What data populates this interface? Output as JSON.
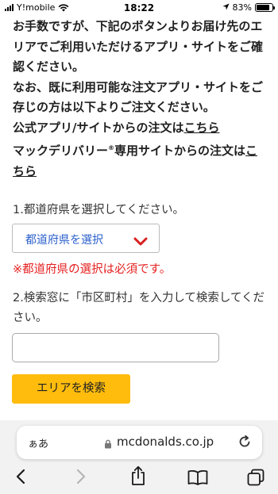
{
  "status_bar": {
    "carrier": "Y!mobile",
    "time": "18:22",
    "battery_percent": "83%",
    "battery_level": 0.83
  },
  "notice": {
    "line1": "お手数ですが、下記のボタンよりお届け先のエリアでご利用いただけるアプリ・サイトをご確認ください。",
    "line2": "なお、既に利用可能な注文アプリ・サイトをご存じの方は以下よりご注文ください。",
    "official_prefix": "公式アプリ/サイトからの注文は",
    "official_link": "こちら",
    "delivery_prefix": "マックデリバリー",
    "delivery_mark": "®",
    "delivery_suffix": "専用サイトからの注文は",
    "delivery_link": "こちら"
  },
  "form": {
    "step1_label": "1.都道府県を選択してください。",
    "prefecture_select_value": "都道府県を選択",
    "error_message": "※都道府県の選択は必須です。",
    "step2_label": "2.検索窓に「市区町村」を入力して検索してください。",
    "search_input_value": "",
    "search_button_label": "エリアを検索"
  },
  "browser": {
    "aa_label": "ぁあ",
    "url": "mcdonalds.co.jp"
  },
  "colors": {
    "accent_yellow": "#ffbc0d",
    "error_red": "#e52020",
    "select_text_blue": "#2a5fcc",
    "chevron_red": "#d81e1e"
  },
  "icons": [
    "wifi-icon",
    "location-arrow-icon",
    "battery-icon",
    "chevron-down-icon",
    "lock-icon",
    "reload-icon",
    "back-icon",
    "forward-icon",
    "share-icon",
    "bookmarks-icon",
    "tabs-icon"
  ]
}
